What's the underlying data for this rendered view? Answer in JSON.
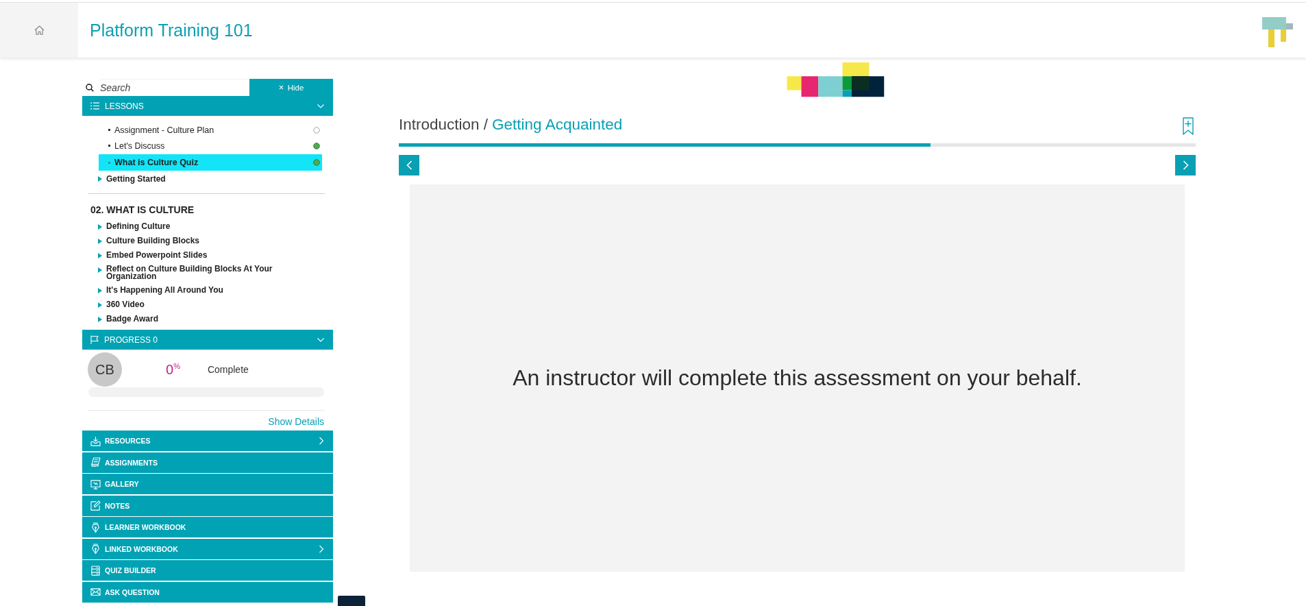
{
  "header": {
    "title": "Platform Training 101"
  },
  "sidebar": {
    "search": {
      "placeholder": "Search"
    },
    "hide_button": {
      "label": "Hide"
    },
    "lessons_panel": {
      "title": "LESSONS",
      "expanded": true,
      "items": [
        {
          "kind": "lesson",
          "label": "Assignment - Culture Plan",
          "done": false,
          "selected": false
        },
        {
          "kind": "lesson",
          "label": "Let's Discuss",
          "done": true,
          "selected": false
        },
        {
          "kind": "lesson",
          "label": "What is Culture Quiz",
          "done": true,
          "selected": true
        },
        {
          "kind": "topic",
          "label": "Getting Started",
          "selected": false
        }
      ],
      "section": {
        "title": "02. WHAT IS CULTURE",
        "topics": [
          {
            "label": "Defining Culture",
            "selected": false
          },
          {
            "label": "Culture Building Blocks",
            "selected": false
          },
          {
            "label": "Embed Powerpoint Slides",
            "selected": false
          },
          {
            "label": "Reflect on Culture Building Blocks At Your Organization",
            "selected": false
          },
          {
            "label": "It's Happening All Around You",
            "selected": false
          },
          {
            "label": "360 Video",
            "selected": false
          },
          {
            "label": "Badge Award",
            "selected": false
          }
        ]
      }
    },
    "progress_panel": {
      "title": "PROGRESS 0",
      "expanded": true,
      "avatar": "CB",
      "percent": "0$^{%}$",
      "status": "Complete",
      "level": 0,
      "details_link": "Show Details"
    },
    "menu": [
      {
        "label": "RESOURCES",
        "submenu": true
      },
      {
        "label": "ASSIGNMENTS",
        "submenu": false
      },
      {
        "label": "GALLERY",
        "submenu": false
      },
      {
        "label": "NOTES",
        "submenu": false
      },
      {
        "label": "LEARNER WORKBOOK",
        "submenu": false
      },
      {
        "label": "LINKED WORKBOOK",
        "submenu": true
      },
      {
        "label": "QUIZ BUILDER",
        "submenu": false
      },
      {
        "label": "ASK QUESTION",
        "submenu": false
      }
    ]
  },
  "main": {
    "breadcrumb": {
      "parent": "Introduction /",
      "current": "Getting Acquainted"
    },
    "progress": {
      "level": 0.667
    },
    "message": "An instructor will complete this assessment on your behalf."
  }
}
